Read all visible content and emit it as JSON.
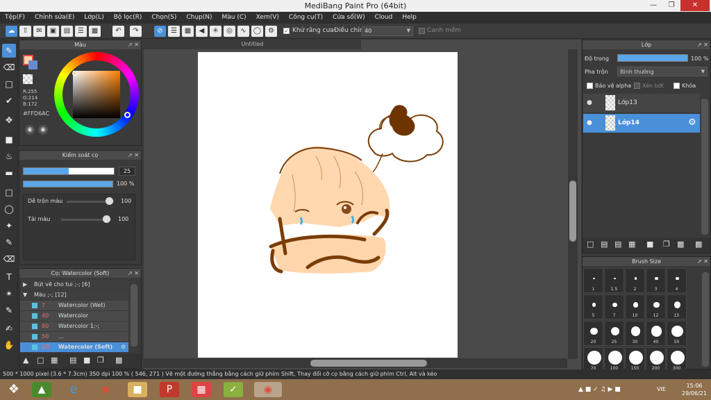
{
  "window": {
    "title": "MediBang Paint Pro (64bit)"
  },
  "menu": [
    "Tệp(F)",
    "Chỉnh sửa(E)",
    "Lớp(L)",
    "Bộ lọc(R)",
    "Chọn(S)",
    "Chụp(N)",
    "Màu (C)",
    "Xem(V)",
    "Công cụ(T)",
    "Cửa sổ(W)",
    "Cloud",
    "Help"
  ],
  "toolbar": {
    "antialias_label": "Khử răng cưa",
    "adjust_label": "Điều chỉnh",
    "adjust_value": "40",
    "edge_label": "Canh mềm"
  },
  "color_panel": {
    "title": "Màu",
    "r": "R:255",
    "g": "G:214",
    "b": "B:172",
    "hex": "#FFD6AC",
    "fg_color": "#FFD6AC"
  },
  "brush_control": {
    "title": "Kiểm soát cọ",
    "size_value": "25",
    "size_fraction": 0.5,
    "opacity_value": "100 %",
    "blend_label": "Dễ trộn màu",
    "blend_value": "100",
    "ink_label": "Tải màu",
    "ink_value": "100"
  },
  "brush_list": {
    "title": "Cọ: Watercolor (Soft)",
    "groups": [
      {
        "label": "Bút vẽ cho tui ;-; [6]"
      },
      {
        "label": "Màu ;-; [12]"
      }
    ],
    "items": [
      {
        "size": "7",
        "name": "Watercolor (Wet)"
      },
      {
        "size": "40",
        "name": "Watercolor"
      },
      {
        "size": "80",
        "name": "Watercolor 1;-;"
      },
      {
        "size": "50",
        "name": "..."
      },
      {
        "size": "25",
        "name": "Watercolor (Soft)"
      }
    ]
  },
  "canvas": {
    "tab_title": "Untitled"
  },
  "layer_panel": {
    "title": "Lớp",
    "opacity_label": "Độ trong",
    "opacity_value": "100 %",
    "blend_label": "Pha trộn",
    "blend_value": "Bình thường",
    "protect_alpha": "Bảo vệ alpha",
    "clipping": "Xén bớt",
    "lock": "Khóa",
    "layers": [
      {
        "name": "Lớp13"
      },
      {
        "name": "Lớp14"
      }
    ]
  },
  "brush_size": {
    "title": "Brush Size",
    "sizes": [
      "1",
      "1.5",
      "2",
      "3",
      "4",
      "5",
      "7",
      "10",
      "12",
      "15",
      "20",
      "25",
      "30",
      "40",
      "50",
      "70",
      "100",
      "150",
      "200",
      "300"
    ]
  },
  "status": {
    "text": "500 * 1000 pixel   (3.6 * 7.3cm)   350 dpi   100 %   ( 546, 271 )   Vẽ một đường thẳng bằng cách giữ phím Shift, Thay đổi cỡ cọ bằng cách giữ phím Ctrl, Alt và kéo"
  },
  "taskbar": {
    "lang": "VIE",
    "time": "15:06",
    "date": "29/06/21"
  },
  "colors": {
    "accent": "#4a90d9",
    "hair": "#ffd6ac",
    "line": "#7a3d08"
  }
}
